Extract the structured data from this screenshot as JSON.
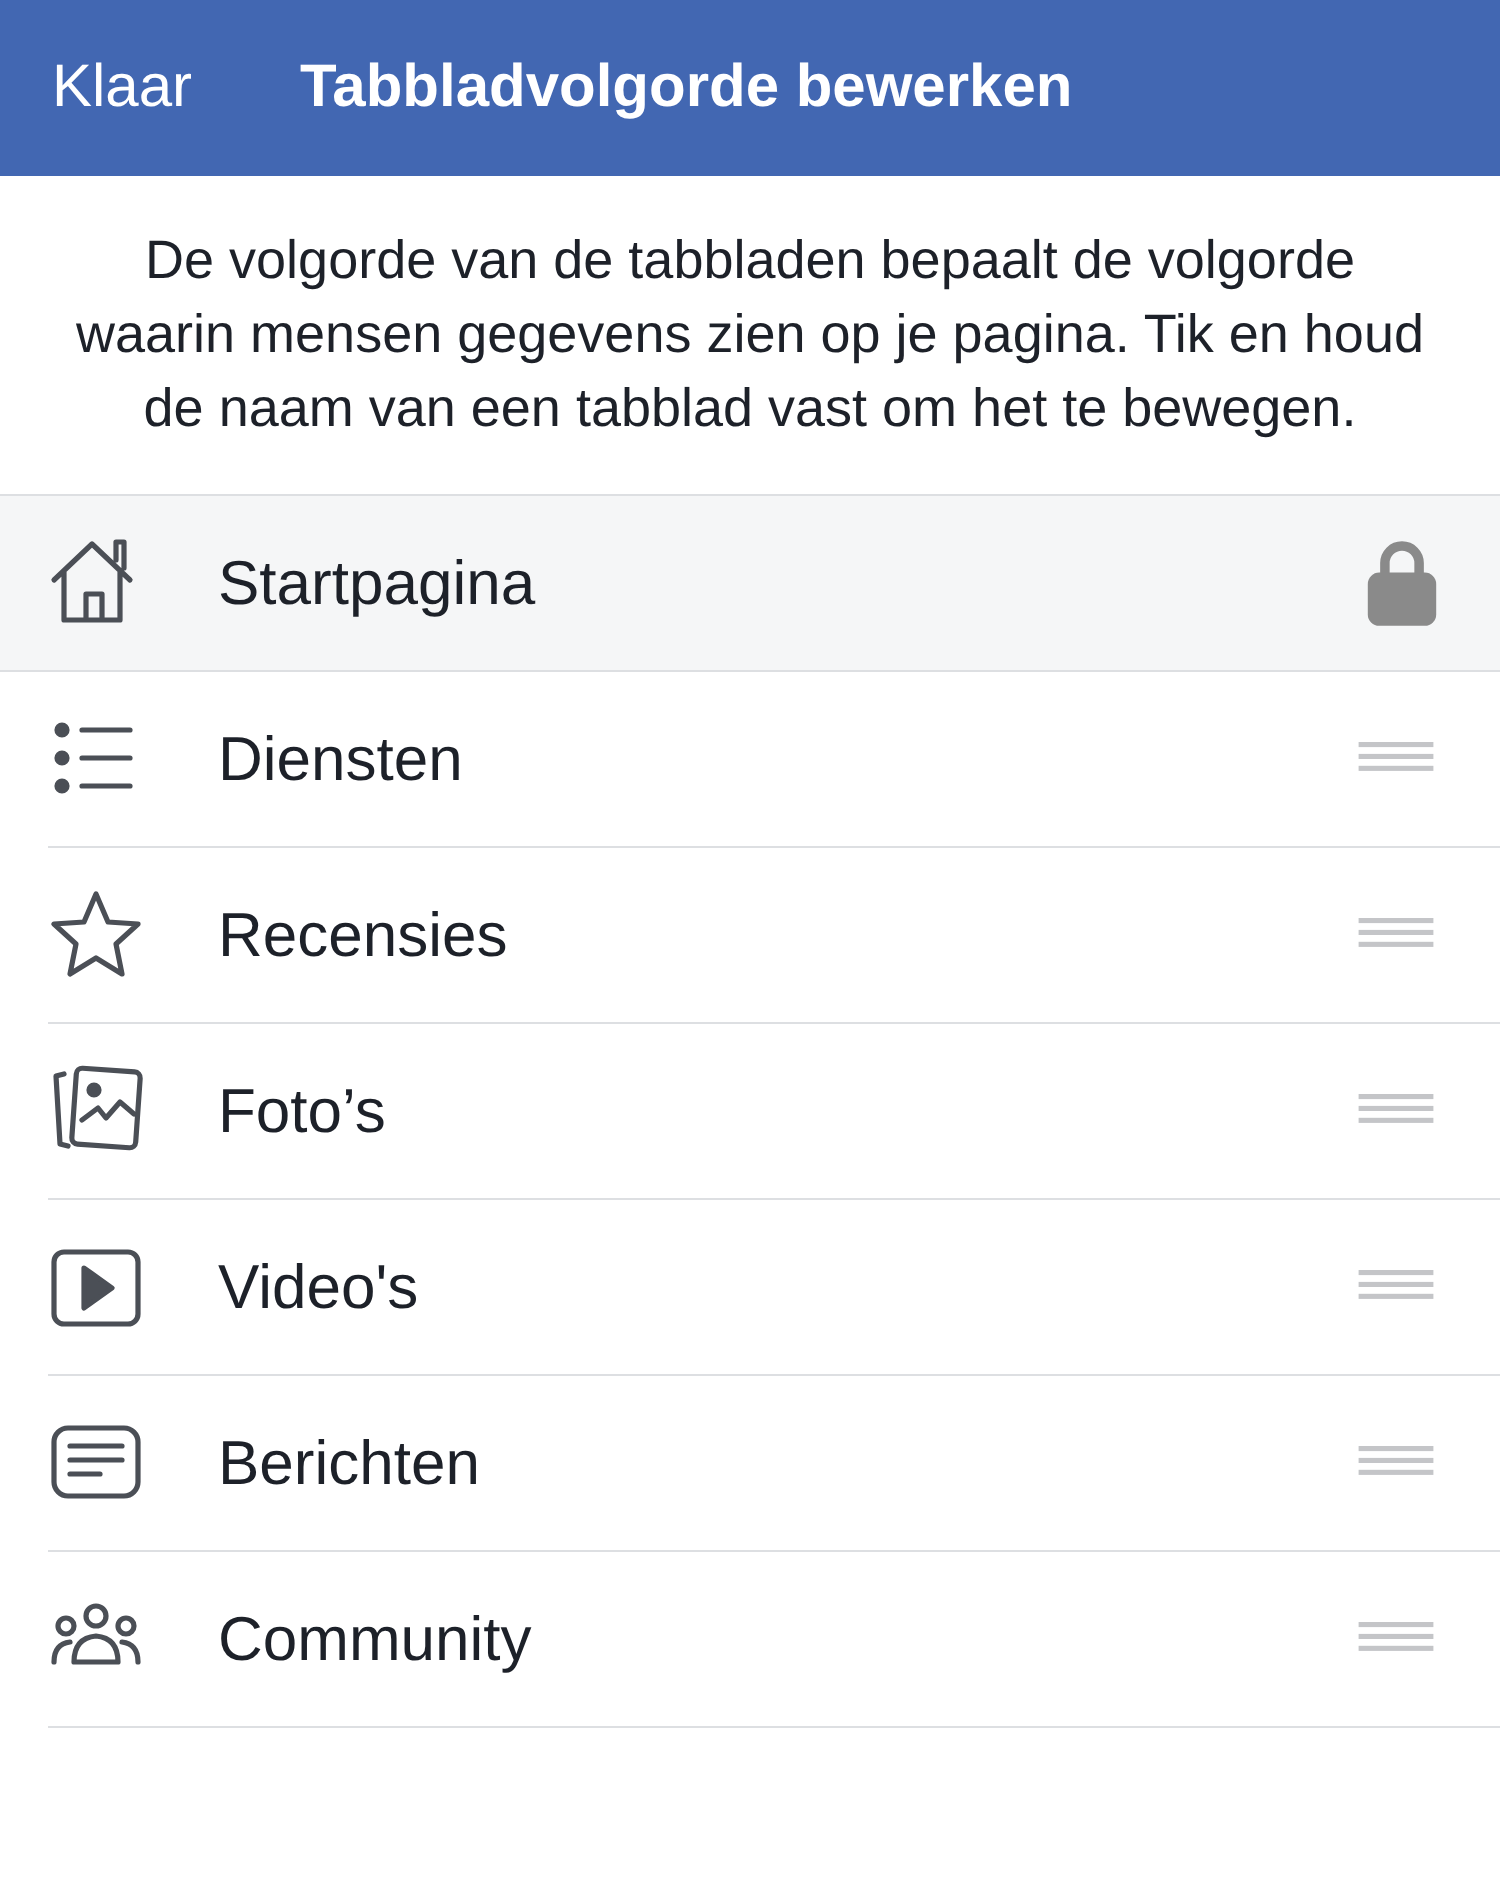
{
  "header": {
    "done_button": "Klaar",
    "title": "Tabbladvolgorde bewerken"
  },
  "description": "De volgorde van de tabbladen bepaalt de volgorde waarin mensen gegevens zien op je pagina. Tik en houd de naam van een tabblad vast om het te bewegen.",
  "tabs": [
    {
      "label": "Startpagina",
      "locked": true
    },
    {
      "label": "Diensten",
      "locked": false
    },
    {
      "label": "Recensies",
      "locked": false
    },
    {
      "label": "Foto’s",
      "locked": false
    },
    {
      "label": "Video's",
      "locked": false
    },
    {
      "label": "Berichten",
      "locked": false
    },
    {
      "label": "Community",
      "locked": false
    }
  ]
}
